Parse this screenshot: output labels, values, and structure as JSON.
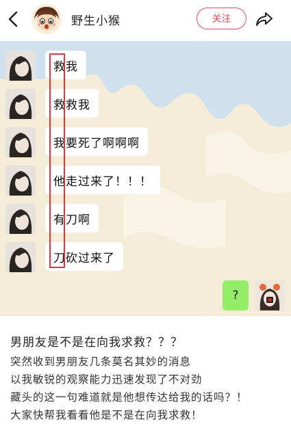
{
  "header": {
    "username": "野生小猴",
    "follow_label": "关注",
    "back_icon": "chevron-left-icon",
    "share_icon": "share-arrow-icon"
  },
  "chat": {
    "received_messages": [
      {
        "text": "救我"
      },
      {
        "text": "救救我"
      },
      {
        "text": "我要死了啊啊啊"
      },
      {
        "text": "他走过来了！！！"
      },
      {
        "text": "有刀啊"
      },
      {
        "text": "刀砍过来了"
      }
    ],
    "sent_message": "?",
    "colors": {
      "background": "#f5ecd8",
      "sky": "#cfe0ee",
      "sent_bubble": "#95ec69",
      "highlight": "#d9363e"
    }
  },
  "post": {
    "title": "男朋友是不是在向我求救？？？",
    "lines": [
      "突然收到男朋友几条莫名其妙的消息",
      "以我敏锐的观察能力迅速发现了不对劲",
      "藏头的这一句难道就是他想传达给我的话吗？！",
      "大家快帮我看看他是不是在向我求救！"
    ]
  },
  "accent_color": "#e84a5f"
}
